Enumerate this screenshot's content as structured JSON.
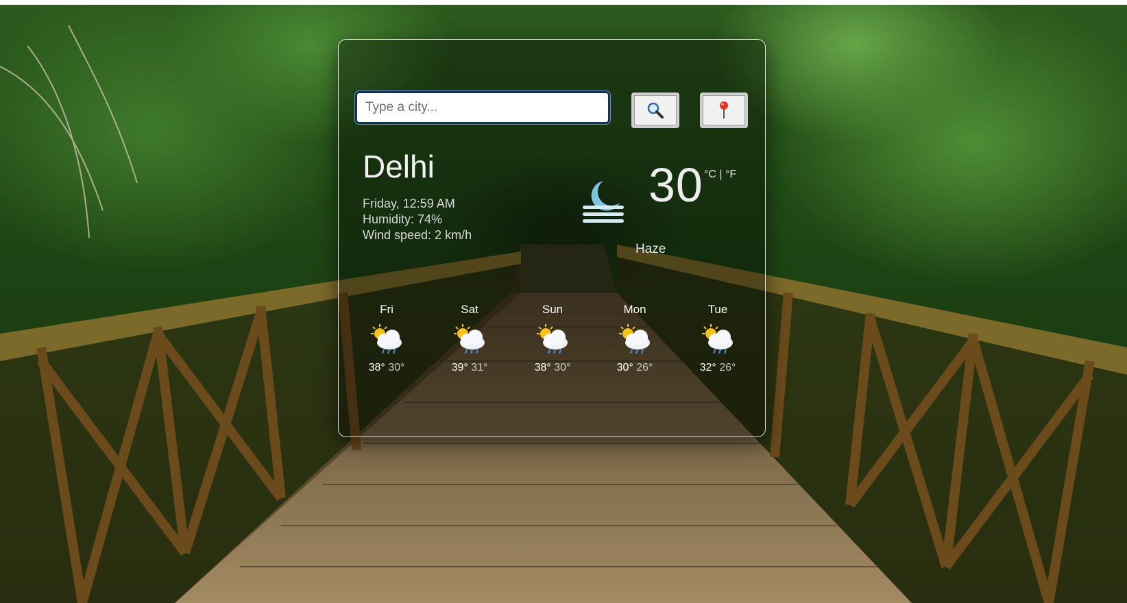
{
  "search": {
    "placeholder": "Type a city...",
    "search_icon": "magnifier-icon",
    "locate_icon": "pushpin-icon"
  },
  "current": {
    "city": "Delhi",
    "datetime": "Friday, 12:59 AM",
    "humidity": "Humidity: 74%",
    "wind": "Wind speed: 2 km/h",
    "temperature": "30",
    "units": "°C | °F",
    "condition": "Haze",
    "icon": "haze-moon-icon"
  },
  "forecast": [
    {
      "day": "Fri",
      "max": "38°",
      "min": "30°",
      "icon": "sun-cloud-rain-icon"
    },
    {
      "day": "Sat",
      "max": "39°",
      "min": "31°",
      "icon": "sun-cloud-rain-icon"
    },
    {
      "day": "Sun",
      "max": "38°",
      "min": "30°",
      "icon": "sun-cloud-rain-icon"
    },
    {
      "day": "Mon",
      "max": "30°",
      "min": "26°",
      "icon": "sun-cloud-rain-icon"
    },
    {
      "day": "Tue",
      "max": "32°",
      "min": "26°",
      "icon": "sun-cloud-rain-icon"
    }
  ],
  "colors": {
    "moon": "#7fc3dc",
    "haze_lines": "#cfe6f0",
    "card_border": "#ffffff"
  }
}
